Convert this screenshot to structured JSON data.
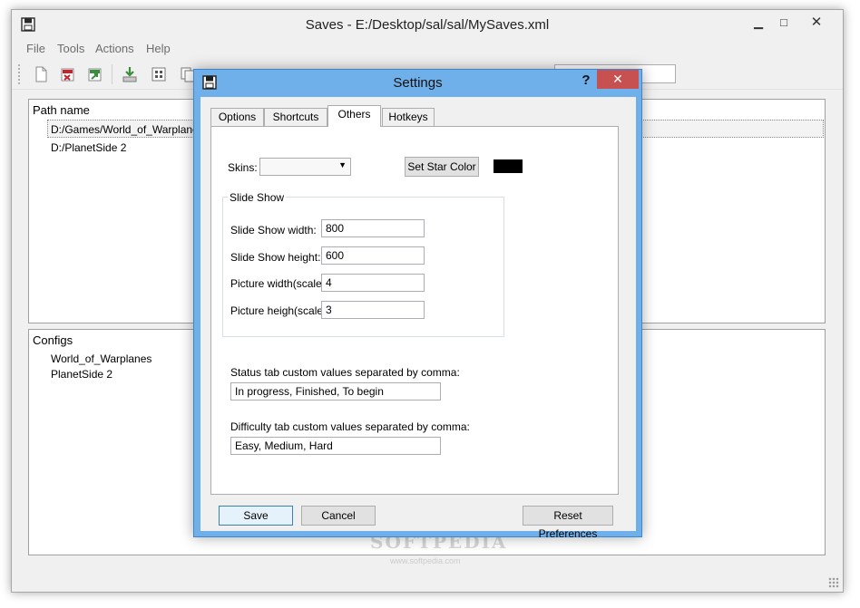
{
  "window": {
    "title": "Saves - E:/Desktop/sal/sal/MySaves.xml",
    "minimize_glyph": "▁",
    "maximize_glyph": "□",
    "close_glyph": "✕"
  },
  "menu": [
    "File",
    "Tools",
    "Actions",
    "Help"
  ],
  "toolbar": {
    "icons": [
      "new-file-icon",
      "delete-icon",
      "export-icon",
      "download-icon",
      "grid-icon",
      "copy-icon"
    ]
  },
  "paths_panel": {
    "header": "Path name",
    "rows": [
      "D:/Games/World_of_Warplanes",
      "D:/PlanetSide 2"
    ]
  },
  "configs_panel": {
    "header": "Configs",
    "rows": [
      "World_of_Warplanes",
      "PlanetSide 2"
    ]
  },
  "settings": {
    "title": "Settings",
    "help_glyph": "?",
    "close_glyph": "✕",
    "tabs": [
      "Options",
      "Shortcuts",
      "Others",
      "Hotkeys"
    ],
    "active_tab": "Others",
    "skins_label": "Skins:",
    "skins_value": "",
    "combo_arrow": "▼",
    "set_star_color_label": "Set Star Color",
    "star_color": "#000000",
    "slideshow_group_title": "Slide Show",
    "slideshow_width_label": "Slide Show width:",
    "slideshow_width_value": "800",
    "slideshow_height_label": "Slide Show height:",
    "slideshow_height_value": "600",
    "picture_width_label": "Picture width(scale):",
    "picture_width_value": "4",
    "picture_height_label": "Picture heigh(scale):",
    "picture_height_value": "3",
    "status_label": "Status tab custom values separated by comma:",
    "status_value": "In progress, Finished, To begin",
    "difficulty_label": "Difficulty tab custom values separated by comma:",
    "difficulty_value": "Easy, Medium, Hard",
    "save_label": "Save",
    "cancel_label": "Cancel",
    "reset_label": "Reset Preferences"
  },
  "watermark": {
    "brand": "SOFTPEDIA",
    "url": "www.softpedia.com"
  },
  "colors": {
    "dialog_frame": "#6fb0ea",
    "close_red": "#c75050",
    "window_bg": "#f0f0f0"
  }
}
